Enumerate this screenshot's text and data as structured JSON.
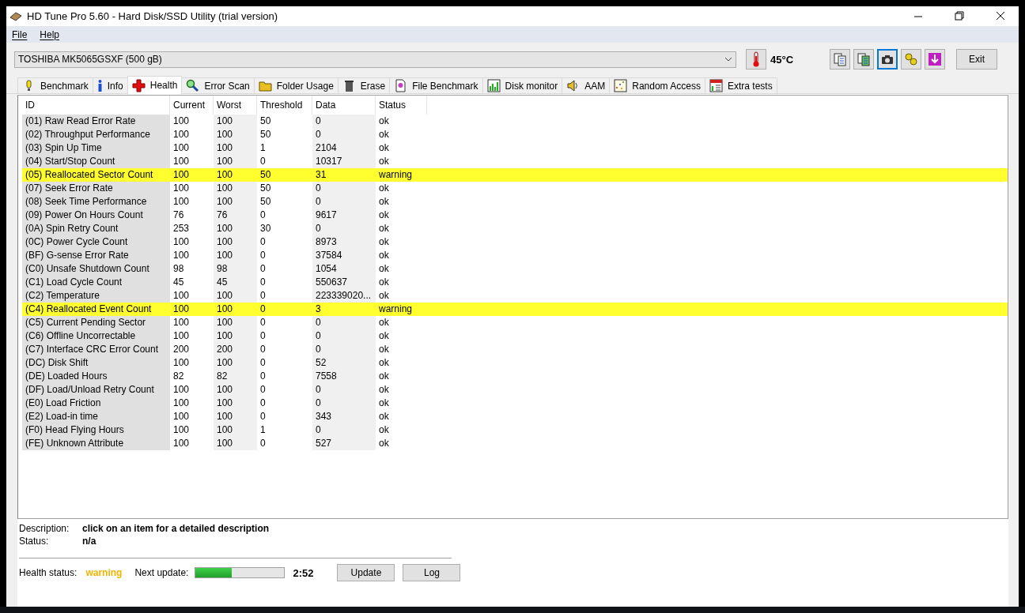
{
  "window": {
    "title": "HD Tune Pro 5.60 - Hard Disk/SSD Utility (trial version)"
  },
  "menu": [
    "File",
    "Help"
  ],
  "drive": {
    "value": "TOSHIBA MK5065GSXF (500 gB)"
  },
  "temperature": "45°C",
  "toolbar_buttons": [
    {
      "selected": false
    },
    {
      "selected": false
    },
    {
      "selected": true
    },
    {
      "selected": false
    },
    {
      "selected": false
    }
  ],
  "exit_button": "Exit",
  "tabs": [
    {
      "label": "Benchmark",
      "selected": false
    },
    {
      "label": "Info",
      "selected": false
    },
    {
      "label": "Health",
      "selected": true
    },
    {
      "label": "Error Scan",
      "selected": false
    },
    {
      "label": "Folder Usage",
      "selected": false
    },
    {
      "label": "Erase",
      "selected": false
    },
    {
      "label": "File Benchmark",
      "selected": false
    },
    {
      "label": "Disk monitor",
      "selected": false
    },
    {
      "label": "AAM",
      "selected": false
    },
    {
      "label": "Random Access",
      "selected": false
    },
    {
      "label": "Extra tests",
      "selected": false
    }
  ],
  "table": {
    "columns": [
      "ID",
      "Current",
      "Worst",
      "Threshold",
      "Data",
      "Status"
    ],
    "rows": [
      {
        "cells": [
          "(01) Raw Read Error Rate",
          "100",
          "100",
          "50",
          "0",
          "ok"
        ],
        "highlighted": false
      },
      {
        "cells": [
          "(02) Throughput Performance",
          "100",
          "100",
          "50",
          "0",
          "ok"
        ],
        "highlighted": false
      },
      {
        "cells": [
          "(03) Spin Up Time",
          "100",
          "100",
          "1",
          "2104",
          "ok"
        ],
        "highlighted": false
      },
      {
        "cells": [
          "(04) Start/Stop Count",
          "100",
          "100",
          "0",
          "10317",
          "ok"
        ],
        "highlighted": false
      },
      {
        "cells": [
          "(05) Reallocated Sector Count",
          "100",
          "100",
          "50",
          "31",
          "warning"
        ],
        "highlighted": true
      },
      {
        "cells": [
          "(07) Seek Error Rate",
          "100",
          "100",
          "50",
          "0",
          "ok"
        ],
        "highlighted": false
      },
      {
        "cells": [
          "(08) Seek Time Performance",
          "100",
          "100",
          "50",
          "0",
          "ok"
        ],
        "highlighted": false
      },
      {
        "cells": [
          "(09) Power On Hours Count",
          "76",
          "76",
          "0",
          "9617",
          "ok"
        ],
        "highlighted": false
      },
      {
        "cells": [
          "(0A) Spin Retry Count",
          "253",
          "100",
          "30",
          "0",
          "ok"
        ],
        "highlighted": false
      },
      {
        "cells": [
          "(0C) Power Cycle Count",
          "100",
          "100",
          "0",
          "8973",
          "ok"
        ],
        "highlighted": false
      },
      {
        "cells": [
          "(BF) G-sense Error Rate",
          "100",
          "100",
          "0",
          "37584",
          "ok"
        ],
        "highlighted": false
      },
      {
        "cells": [
          "(C0) Unsafe Shutdown Count",
          "98",
          "98",
          "0",
          "1054",
          "ok"
        ],
        "highlighted": false
      },
      {
        "cells": [
          "(C1) Load Cycle Count",
          "45",
          "45",
          "0",
          "550637",
          "ok"
        ],
        "highlighted": false
      },
      {
        "cells": [
          "(C2) Temperature",
          "100",
          "100",
          "0",
          "223339020...",
          "ok"
        ],
        "highlighted": false
      },
      {
        "cells": [
          "(C4) Reallocated Event Count",
          "100",
          "100",
          "0",
          "3",
          "warning"
        ],
        "highlighted": true
      },
      {
        "cells": [
          "(C5) Current Pending Sector",
          "100",
          "100",
          "0",
          "0",
          "ok"
        ],
        "highlighted": false
      },
      {
        "cells": [
          "(C6) Offline Uncorrectable",
          "100",
          "100",
          "0",
          "0",
          "ok"
        ],
        "highlighted": false
      },
      {
        "cells": [
          "(C7) Interface CRC Error Count",
          "200",
          "200",
          "0",
          "0",
          "ok"
        ],
        "highlighted": false
      },
      {
        "cells": [
          "(DC) Disk Shift",
          "100",
          "100",
          "0",
          "52",
          "ok"
        ],
        "highlighted": false
      },
      {
        "cells": [
          "(DE) Loaded Hours",
          "82",
          "82",
          "0",
          "7558",
          "ok"
        ],
        "highlighted": false
      },
      {
        "cells": [
          "(DF) Load/Unload Retry Count",
          "100",
          "100",
          "0",
          "0",
          "ok"
        ],
        "highlighted": false
      },
      {
        "cells": [
          "(E0) Load Friction",
          "100",
          "100",
          "0",
          "0",
          "ok"
        ],
        "highlighted": false
      },
      {
        "cells": [
          "(E2) Load-in time",
          "100",
          "100",
          "0",
          "343",
          "ok"
        ],
        "highlighted": false
      },
      {
        "cells": [
          "(F0) Head Flying Hours",
          "100",
          "100",
          "1",
          "0",
          "ok"
        ],
        "highlighted": false
      },
      {
        "cells": [
          "(FE) Unknown Attribute",
          "100",
          "100",
          "0",
          "527",
          "ok"
        ],
        "highlighted": false
      }
    ]
  },
  "details": {
    "description_label": "Description:",
    "description": "click on an item for a detailed description",
    "status_label": "Status:",
    "status": "n/a"
  },
  "footer": {
    "health_label": "Health status:",
    "health": "warning",
    "next_update_label": "Next update:",
    "level": 0.41,
    "time": "2:52",
    "buttons": [
      "Update",
      "Log"
    ]
  }
}
